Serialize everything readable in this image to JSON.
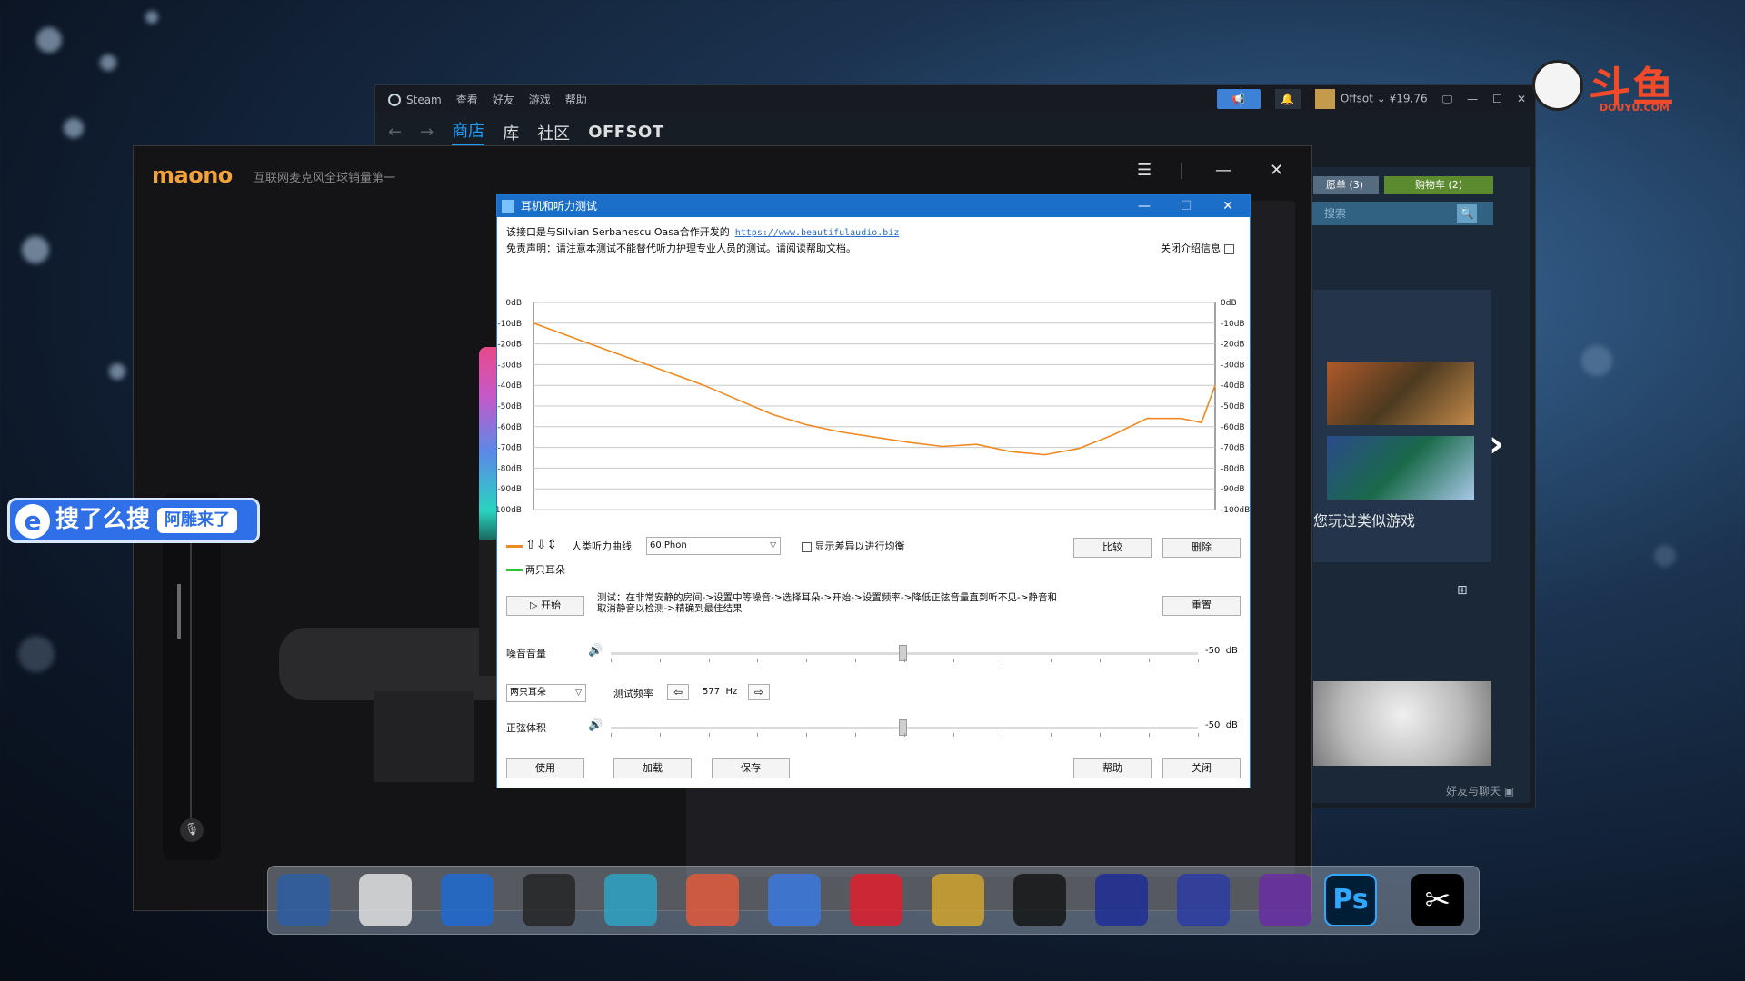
{
  "steam": {
    "menu": [
      "Steam",
      "查看",
      "好友",
      "游戏",
      "帮助"
    ],
    "user": "Offsot ⌄ ¥19.76",
    "nav": {
      "back": "←",
      "forward": "→",
      "tabs": [
        "商店",
        "库",
        "社区",
        "OFFSOT"
      ]
    },
    "wishlist": "愿单 (3)",
    "cart": "购物车 (2)",
    "search_placeholder": "搜索",
    "similar_label": "您玩过类似游戏",
    "friends_chat": "好友与聊天"
  },
  "maono": {
    "logo": "maono",
    "tagline": "互联网麦克风全球销量第一",
    "mic_label": "maono"
  },
  "dialog": {
    "title": "耳机和听力测试",
    "info_line1": "该接口是与Silvian Serbanescu Oasa合作开发的",
    "info_link": "https://www.beautifulaudio.biz",
    "info_line2": "免责声明：请注意本测试不能替代听力护理专业人员的测试。请阅读帮助文档。",
    "close_info_label": "关闭介绍信息",
    "chart_data": {
      "type": "line",
      "y_ticks": [
        "0dB",
        "-10dB",
        "-20dB",
        "-30dB",
        "-40dB",
        "-50dB",
        "-60dB",
        "-70dB",
        "-80dB",
        "-90dB",
        "-100dB"
      ],
      "ylim": [
        -100,
        0
      ],
      "grid": true,
      "series": [
        {
          "name": "人类听力曲线",
          "color": "#f08a20",
          "x": [
            0,
            0.05,
            0.1,
            0.15,
            0.2,
            0.25,
            0.3,
            0.35,
            0.4,
            0.45,
            0.5,
            0.55,
            0.6,
            0.65,
            0.7,
            0.75,
            0.8,
            0.85,
            0.9,
            0.95,
            0.98,
            1.0
          ],
          "y": [
            -10,
            -16,
            -22,
            -28,
            -34,
            -40,
            -47,
            -54,
            -59,
            -62.5,
            -65,
            -67.5,
            -69.5,
            -68.5,
            -72,
            -73.5,
            -70.5,
            -64,
            -56,
            -56,
            -58,
            -40
          ]
        }
      ]
    },
    "hearing_curve_label": "人类听力曲线",
    "curve_arrows": "⇧⇩⇕",
    "phon_select": "60 Phon",
    "show_diff_label": "显示差异以进行均衡",
    "compare_btn": "比较",
    "delete_btn": "删除",
    "both_ears_legend": "两只耳朵",
    "start_btn": "▷  开始",
    "instructions": "测试：在非常安静的房间->设置中等噪音->选择耳朵->开始->设置频率->降低正弦音量直到听不见->静音和取消静音以检测->精确到最佳结果",
    "reset_btn": "重置",
    "noise_volume_label": "噪音音量",
    "noise_value": "-50",
    "noise_unit": "dB",
    "ear_select": "两只耳朵",
    "test_freq_label": "测试频率",
    "freq_value": "577",
    "freq_unit": "Hz",
    "sine_volume_label": "正弦体积",
    "sine_value": "-50",
    "sine_unit": "dB",
    "use_btn": "使用",
    "load_btn": "加载",
    "save_btn": "保存",
    "help_btn": "帮助",
    "close_btn": "关闭",
    "colors": {
      "curve": "#f08a20",
      "both_ears": "#2ec02e",
      "titlebar": "#1c6fc9"
    }
  },
  "overlay": {
    "search_icon_letter": "e",
    "search_text": "搜了么搜",
    "search_sub": "阿雕来了",
    "douyu": "斗鱼",
    "douyu_sub": "DOUYU.COM"
  },
  "dock": {
    "ps": "Ps",
    "capcut": "✂"
  }
}
